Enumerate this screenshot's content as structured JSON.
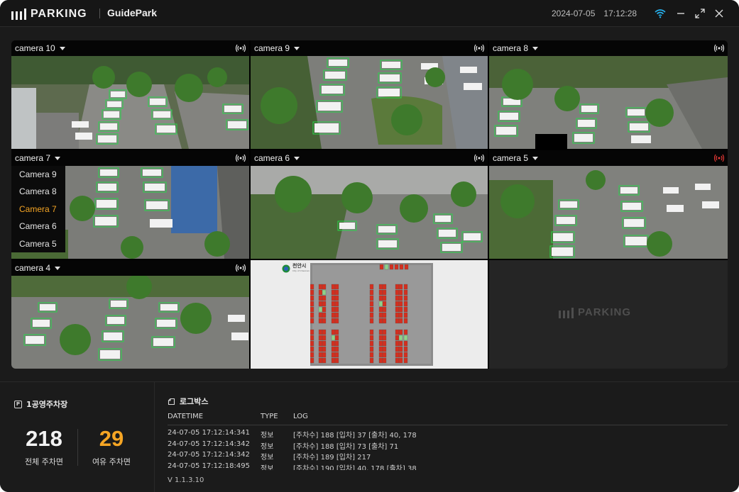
{
  "app": {
    "brand": "PARKING",
    "name": "GuidePark"
  },
  "titlebar": {
    "date": "2024-07-05",
    "time": "17:12:28"
  },
  "colors": {
    "accent": "#f5a524",
    "detect": "#27d84a",
    "alert": "#e53935"
  },
  "cameras": [
    {
      "name": "camera 10",
      "signal": "ok"
    },
    {
      "name": "camera 9",
      "signal": "ok"
    },
    {
      "name": "camera 8",
      "signal": "ok"
    },
    {
      "name": "camera 7",
      "signal": "ok"
    },
    {
      "name": "camera 6",
      "signal": "ok"
    },
    {
      "name": "camera 5",
      "signal": "alert"
    },
    {
      "name": "camera 4",
      "signal": "ok"
    }
  ],
  "camera_dropdown": {
    "items": [
      "Camera 9",
      "Camera 8",
      "Camera 7",
      "Camera 6",
      "Camera 5"
    ],
    "selected": "Camera 7"
  },
  "map": {
    "city_label": "천안시",
    "city_sub": "City of Cheonan"
  },
  "watermark": "PARKING",
  "lot": {
    "title": "1공영주차장",
    "total": "218",
    "total_label": "전체 주차면",
    "available": "29",
    "available_label": "여유 주차면"
  },
  "log": {
    "title": "로그박스",
    "columns": [
      "DATETIME",
      "TYPE",
      "LOG"
    ],
    "rows": [
      {
        "datetime": "24-07-05   17:12:14:341",
        "type": "정보",
        "log": "[주차수] 188 [입차] 37 [출차] 40, 178"
      },
      {
        "datetime": "24-07-05   17:12:14:342",
        "type": "정보",
        "log": "[주차수] 188 [입차] 73 [출차] 71"
      },
      {
        "datetime": "24-07-05   17:12:14:342",
        "type": "정보",
        "log": "[주차수] 189 [입차] 217"
      },
      {
        "datetime": "24-07-05   17:12:18:495",
        "type": "정보",
        "log": "[주차수] 190 [입차] 40, 178  [출차] 38"
      }
    ]
  },
  "version": "V 1.1.3.10"
}
